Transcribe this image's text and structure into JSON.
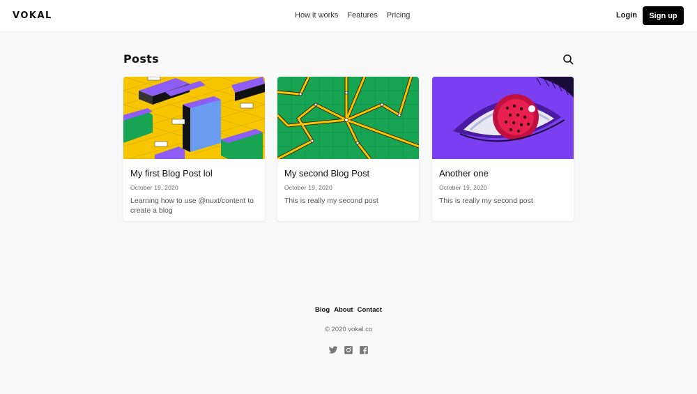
{
  "header": {
    "logo": "VOKAL",
    "nav": [
      "How it works",
      "Features",
      "Pricing"
    ],
    "login": "Login",
    "signup": "Sign up"
  },
  "main": {
    "title": "Posts",
    "posts": [
      {
        "title": "My first Blog Post lol",
        "date": "October 19, 2020",
        "description": "Learning how to use @nuxt/content to create a blog"
      },
      {
        "title": "My second Blog Post",
        "date": "October 19, 2020",
        "description": "This is really my second post"
      },
      {
        "title": "Another one",
        "date": "October 19, 2020",
        "description": "This is really my second post"
      }
    ]
  },
  "footer": {
    "links": [
      "Blog",
      "About",
      "Contact"
    ],
    "copyright": "© 2020 vokal.co",
    "social_icons": [
      "twitter-icon",
      "instagram-icon",
      "facebook-icon"
    ]
  },
  "colors": {
    "yellow": "#f7c600",
    "green": "#17a554",
    "purple": "#7b3ff2",
    "black": "#000000"
  }
}
